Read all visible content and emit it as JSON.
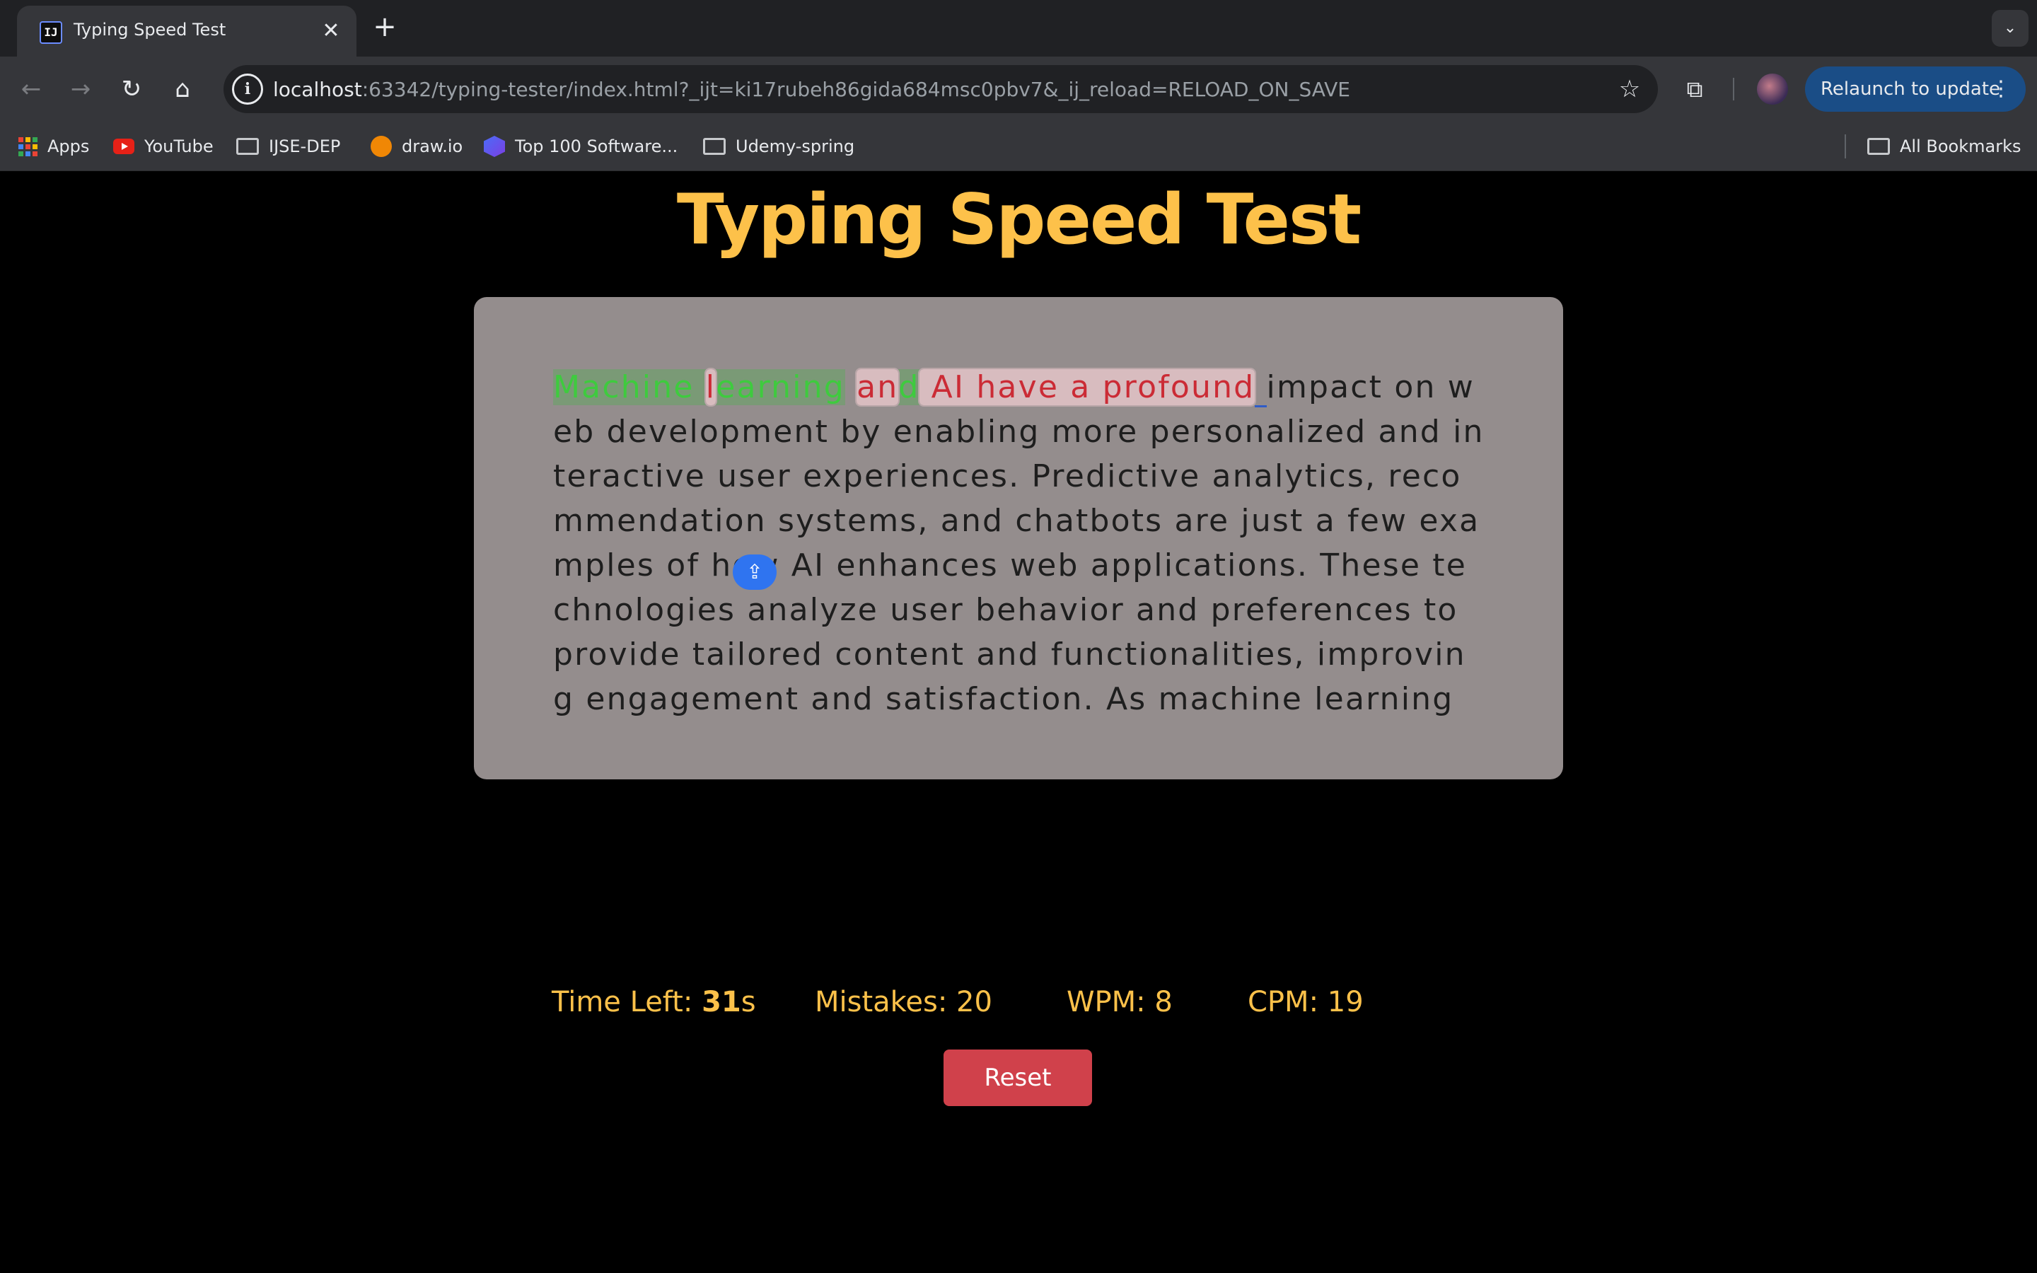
{
  "browser": {
    "tab": {
      "favicon_text": "IJ",
      "title": "Typing Speed Test"
    },
    "url": {
      "host": "localhost",
      "rest": ":63342/typing-tester/index.html?_ijt=ki17rubeh86gida684msc0pbv7&_ij_reload=RELOAD_ON_SAVE"
    },
    "relaunch_label": "Relaunch to update",
    "bookmarks": [
      "Apps",
      "YouTube",
      "IJSE-DEP",
      "draw.io",
      "Top 100 Software...",
      "Udemy-spring"
    ],
    "all_bookmarks_label": "All Bookmarks"
  },
  "page": {
    "title": "Typing Speed Test",
    "typed_correct_1": "Machine ",
    "typed_incorrect_l": "l",
    "typed_correct_2": "earning",
    "typed_incorrect_and": "an",
    "typed_correct_d": "d",
    "typed_incorrect_rest": " AI have a profound",
    "active_char": " ",
    "remaining_text": "impact on web development by enabling more personalized and interactive user experiences. Predictive analytics, recommendation systems, and chatbots are just a few examples of how AI enhances web applications. These technologies analyze user behavior and preferences to provide tailored content and functionalities, improving engagement and satisfaction. As machine learning models become more sophisticated",
    "stats": {
      "time_label": "Time Left:",
      "time_value": "31",
      "time_unit": "s",
      "mistakes_label": "Mistakes:",
      "mistakes_value": "20",
      "wpm_label": "WPM:",
      "wpm_value": "8",
      "cpm_label": "CPM:",
      "cpm_value": "19"
    },
    "reset_label": "Reset"
  },
  "colors": {
    "accent": "#fdc14a",
    "correct": "#3ecb3e",
    "incorrect": "#cb2b35",
    "reset_button": "#d0414b",
    "panel": "#948d8d"
  }
}
